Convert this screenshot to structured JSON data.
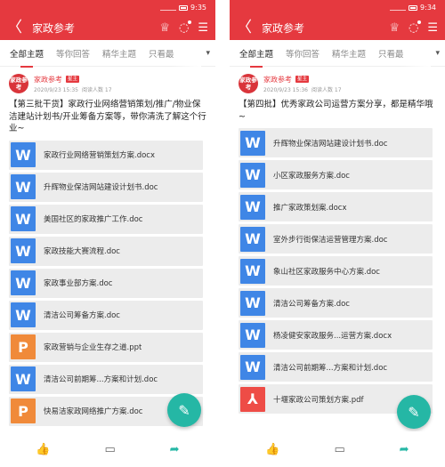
{
  "left": {
    "status": {
      "time": "9:35"
    },
    "header": {
      "back": "〈",
      "title": "家政参考",
      "icon_trophy": "♕",
      "icon_message": "◌",
      "icon_menu": "☰"
    },
    "tabs": [
      {
        "label": "全部主题"
      },
      {
        "label": "等你回答"
      },
      {
        "label": "精华主题"
      },
      {
        "label": "只看最"
      }
    ],
    "tabs_more": "▾",
    "post": {
      "avatar_text": "家政参考",
      "author": "家政参考",
      "badge": "星主",
      "date": "2020/9/23 15:35",
      "reads": "阅读人数 17",
      "title": "【第三批干货】家政行业网络营销策划/推广/物业保洁建站计划书/开业筹备方案等，带你清洗了解这个行业~"
    },
    "files": [
      {
        "name": "家政行业网络营销策划方案.docx",
        "type": "doc",
        "icon": "W"
      },
      {
        "name": "升辉物业保洁网站建设计划书.doc",
        "type": "doc",
        "icon": "W"
      },
      {
        "name": "美国社区的家政推广工作.doc",
        "type": "doc",
        "icon": "W"
      },
      {
        "name": "家政技能大赛流程.doc",
        "type": "doc",
        "icon": "W"
      },
      {
        "name": "家政事业部方案.doc",
        "type": "doc",
        "icon": "W"
      },
      {
        "name": "清洁公司筹备方案.doc",
        "type": "doc",
        "icon": "W"
      },
      {
        "name": "家政营销与企业生存之道.ppt",
        "type": "ppt",
        "icon": "P"
      },
      {
        "name": "清洁公司前期筹...方案和计划.doc",
        "type": "doc",
        "icon": "W"
      },
      {
        "name": "快易洁家政网络推广方案.doc",
        "type": "ppt",
        "icon": "P"
      }
    ],
    "fab_icon": "✎",
    "actions": {
      "like": "👍",
      "comment": "▭",
      "share": "➦"
    }
  },
  "right": {
    "status": {
      "time": "9:34"
    },
    "header": {
      "back": "〈",
      "title": "家政参考",
      "icon_trophy": "♕",
      "icon_message": "◌",
      "icon_menu": "☰"
    },
    "tabs": [
      {
        "label": "全部主题"
      },
      {
        "label": "等你回答"
      },
      {
        "label": "精华主题"
      },
      {
        "label": "只看最"
      }
    ],
    "tabs_more": "▾",
    "post": {
      "avatar_text": "家政参考",
      "author": "家政参考",
      "badge": "星主",
      "date": "2020/9/23 15:36",
      "reads": "阅读人数 17",
      "title": "【第四批】优秀家政公司运营方案分享，都是精华哦~"
    },
    "files": [
      {
        "name": "升辉物业保洁网站建设计划书.doc",
        "type": "doc",
        "icon": "W"
      },
      {
        "name": "小区家政服务方案.doc",
        "type": "doc",
        "icon": "W"
      },
      {
        "name": "推广家政策划案.docx",
        "type": "doc",
        "icon": "W"
      },
      {
        "name": "室外步行街保洁运营管理方案.doc",
        "type": "doc",
        "icon": "W"
      },
      {
        "name": "象山社区家政服务中心方案.doc",
        "type": "doc",
        "icon": "W"
      },
      {
        "name": "清洁公司筹备方案.doc",
        "type": "doc",
        "icon": "W"
      },
      {
        "name": "杨凌健安家政服务...运营方案.docx",
        "type": "doc",
        "icon": "W"
      },
      {
        "name": "清洁公司前期筹...方案和计划.doc",
        "type": "doc",
        "icon": "W"
      },
      {
        "name": "十堰家政公司策划方案.pdf",
        "type": "pdf",
        "icon": "⅄"
      }
    ],
    "fab_icon": "✎",
    "actions": {
      "like": "👍",
      "comment": "▭",
      "share": "➦"
    }
  }
}
